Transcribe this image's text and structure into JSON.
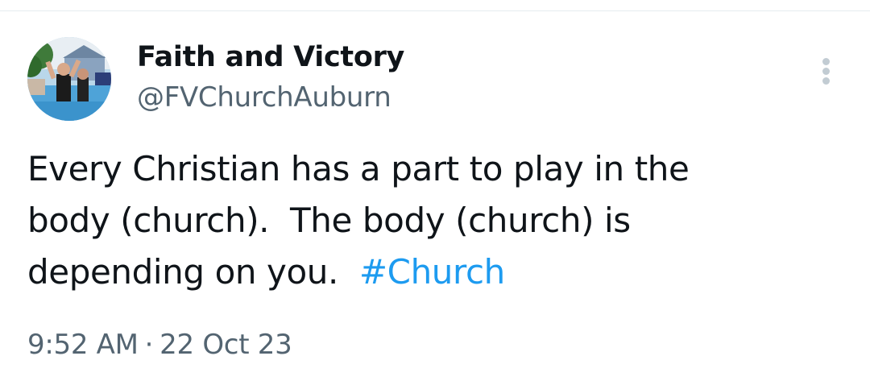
{
  "author": {
    "display_name": "Faith and Victory",
    "handle": "@FVChurchAuburn"
  },
  "menu": {
    "icon": "more-vertical-icon"
  },
  "tweet": {
    "lines": [
      "Every Christian has a part to play in the",
      "body (church).  The body (church) is",
      "depending on you.  "
    ],
    "hashtag": "#Church"
  },
  "meta": {
    "time": "9:52 AM",
    "separator": "·",
    "date": "22 Oct 23"
  },
  "colors": {
    "text": "#0f1419",
    "secondary": "#536471",
    "link": "#1d9bf0",
    "menu_dots": "#c2ccd3"
  }
}
